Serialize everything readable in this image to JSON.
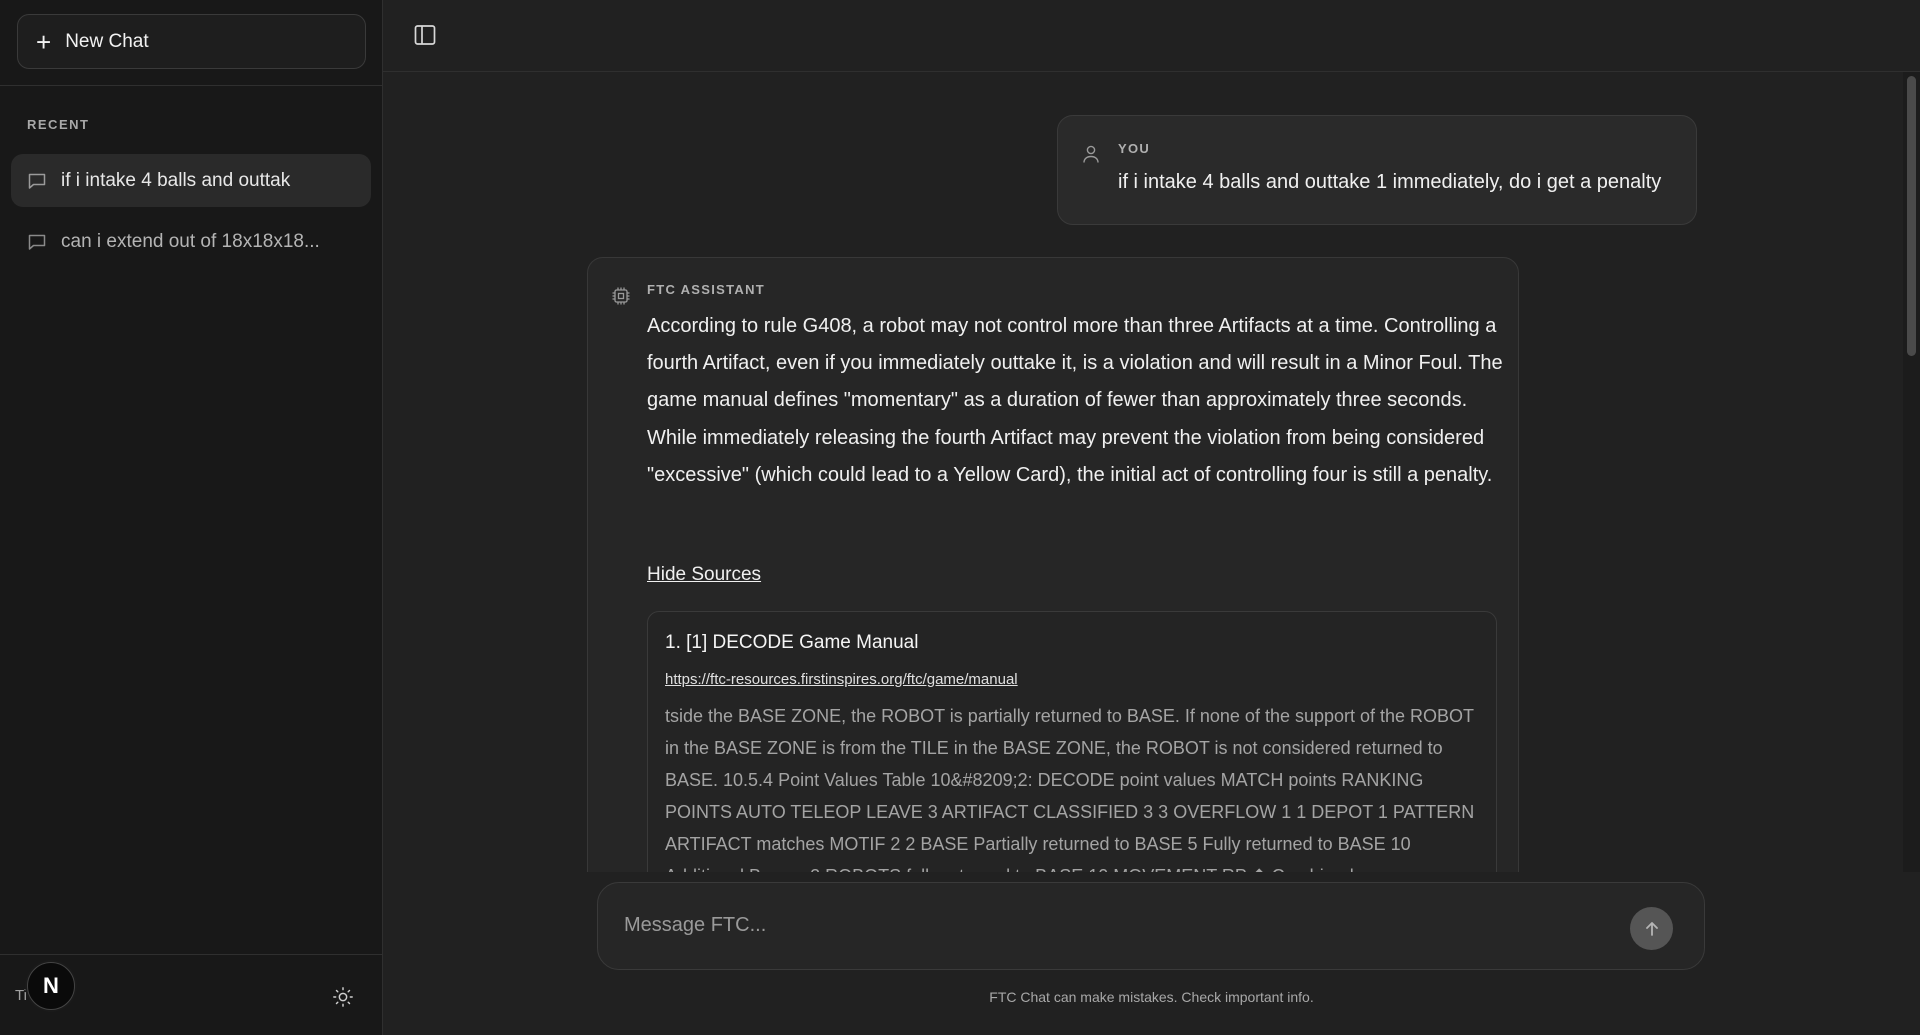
{
  "sidebar": {
    "new_chat_label": "New Chat",
    "recent_label": "RECENT",
    "items": [
      {
        "label": "if i intake 4 balls and outtak"
      },
      {
        "label": "can i extend out of 18x18x18..."
      }
    ],
    "bottom_text": "Ti",
    "avatar_letter": "N"
  },
  "conversation": {
    "user": {
      "role": "YOU",
      "text": "if i intake 4 balls and outtake 1 immediately, do i get a penalty"
    },
    "assistant": {
      "role": "FTC ASSISTANT",
      "text": "According to rule G408, a robot may not control more than three Artifacts at a time. Controlling a fourth Artifact, even if you immediately outtake it, is a violation and will result in a Minor Foul. The game manual defines \"momentary\" as a duration of fewer than approximately three seconds. While immediately releasing the fourth Artifact may prevent the violation from being considered \"excessive\" (which could lead to a Yellow Card), the initial act of controlling four is still a penalty.",
      "hide_sources_label": "Hide Sources",
      "sources": [
        {
          "title": "1. [1] DECODE Game Manual",
          "url": "https://ftc-resources.firstinspires.org/ftc/game/manual",
          "excerpt": "tside the BASE ZONE, the ROBOT is partially returned to BASE. If none of the support of the ROBOT in the BASE ZONE is from the TILE in the BASE ZONE, the ROBOT is not considered returned to BASE. 10.5.4 Point Values Table 10&#8209;2: DECODE point values MATCH points RANKING POINTS AUTO TELEOP LEAVE 3 ARTIFACT CLASSIFIED 3 3 OVERFLOW 1 1 DEPOT 1 PATTERN ARTIFACT matches MOTIF 2 2 BASE Partially returned to BASE 5 Fully returned to BASE 10 Additional Bonus: 2 ROBOTS fully returned to BASE 10 MOVEMENT RP ⬆ Combined"
        }
      ]
    }
  },
  "composer": {
    "placeholder": "Message FTC..."
  },
  "disclaimer": "FTC Chat can make mistakes. Check important info."
}
